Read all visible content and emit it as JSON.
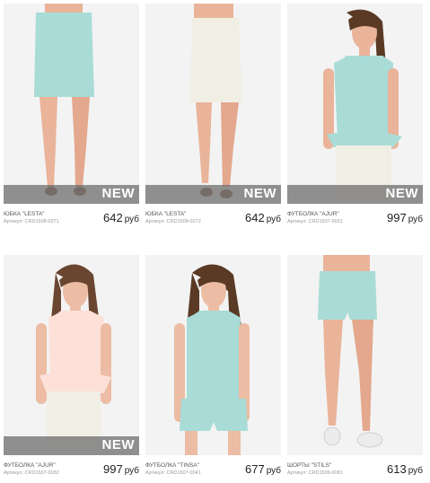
{
  "colors": {
    "mint": "#a9dcd6",
    "cream": "#f1eee4",
    "peach": "#fde1d8",
    "skin": "#e9b49a",
    "hair": "#5a3a24",
    "newbar": "#6e6e6e"
  },
  "products": [
    {
      "name": "ЮБКА \"LESTA\"",
      "sku": "Артикул: CRD1508-0271",
      "price": "642",
      "currency": "руб",
      "new": true,
      "badge": "NEW",
      "image": "mint-pencil-skirt"
    },
    {
      "name": "ЮБКА \"LESTA\"",
      "sku": "Артикул: CRD1508-0272",
      "price": "642",
      "currency": "руб",
      "new": true,
      "badge": "NEW",
      "image": "white-pencil-skirt"
    },
    {
      "name": "ФУТБОЛКА \"AJUR\"",
      "sku": "Артикул: CRD1507-0031",
      "price": "997",
      "currency": "руб",
      "new": true,
      "badge": "NEW",
      "image": "mint-peplum-top"
    },
    {
      "name": "ФУТБОЛКА \"AJUR\"",
      "sku": "Артикул: CRD1507-0032",
      "price": "997",
      "currency": "руб",
      "new": true,
      "badge": "NEW",
      "image": "peach-peplum-top"
    },
    {
      "name": "ФУТБОЛКА \"TINSA\"",
      "sku": "Артикул: CRD1507-0041",
      "price": "677",
      "currency": "руб",
      "new": false,
      "badge": "",
      "image": "mint-top-and-shorts"
    },
    {
      "name": "ШОРТЫ \"STILS\"",
      "sku": "Артикул: CRD1509-0081",
      "price": "613",
      "currency": "руб",
      "new": false,
      "badge": "",
      "image": "mint-shorts"
    }
  ]
}
